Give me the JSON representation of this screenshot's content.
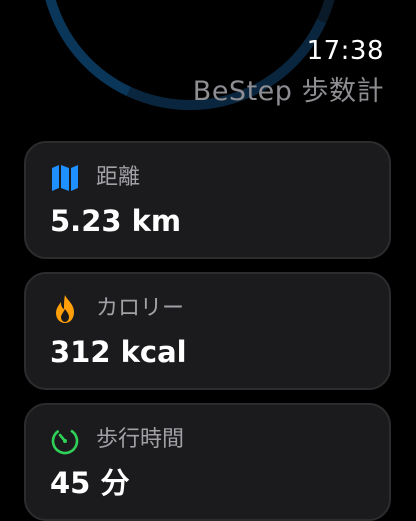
{
  "status": {
    "time": "17:38",
    "app_title": "BeStep 歩数計"
  },
  "cards": [
    {
      "label": "距離",
      "value": "5.23 km",
      "icon": "map-icon",
      "icon_color": "#1e90ff"
    },
    {
      "label": "カロリー",
      "value": "312 kcal",
      "icon": "flame-icon",
      "icon_color": "#ff9f0a"
    },
    {
      "label": "歩行時間",
      "value": "45 分",
      "icon": "timer-icon",
      "icon_color": "#30d158"
    }
  ]
}
